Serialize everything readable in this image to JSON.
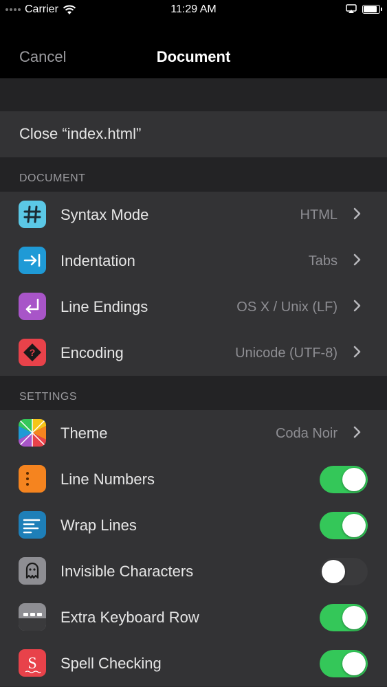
{
  "status_bar": {
    "carrier": "Carrier",
    "time": "11:29 AM",
    "battery_level": 0.95
  },
  "nav": {
    "cancel_label": "Cancel",
    "title": "Document"
  },
  "close_row": {
    "label": "Close “index.html”"
  },
  "sections": {
    "document": {
      "header": "DOCUMENT",
      "rows": [
        {
          "label": "Syntax Mode",
          "value": "HTML",
          "icon": "hash-icon",
          "color": "#5bc8e6"
        },
        {
          "label": "Indentation",
          "value": "Tabs",
          "icon": "indent-arrow-icon",
          "color": "#1f9ad6"
        },
        {
          "label": "Line Endings",
          "value": "OS X / Unix (LF)",
          "icon": "return-arrow-icon",
          "color": "#a855c8"
        },
        {
          "label": "Encoding",
          "value": "Unicode (UTF-8)",
          "icon": "question-diamond-icon",
          "color": "#e8424a"
        }
      ]
    },
    "settings": {
      "header": "SETTINGS",
      "theme": {
        "label": "Theme",
        "value": "Coda Noir",
        "icon": "theme-pinwheel-icon"
      },
      "toggles": [
        {
          "label": "Line Numbers",
          "on": true,
          "icon": "line-numbers-icon",
          "color": "#f5841f"
        },
        {
          "label": "Wrap Lines",
          "on": true,
          "icon": "wrap-lines-icon",
          "color": "#1e7fb8"
        },
        {
          "label": "Invisible Characters",
          "on": false,
          "icon": "ghost-icon",
          "color": "#8e8e93"
        },
        {
          "label": "Extra Keyboard Row",
          "on": true,
          "icon": "keyboard-row-icon",
          "color": "#8e8e93"
        },
        {
          "label": "Spell Checking",
          "on": true,
          "icon": "spell-check-icon",
          "color": "#e8424a"
        }
      ]
    }
  },
  "colors": {
    "toggle_on": "#34c759",
    "toggle_off": "#3a3a3c",
    "row_bg": "#333335",
    "group_bg": "#232325"
  }
}
